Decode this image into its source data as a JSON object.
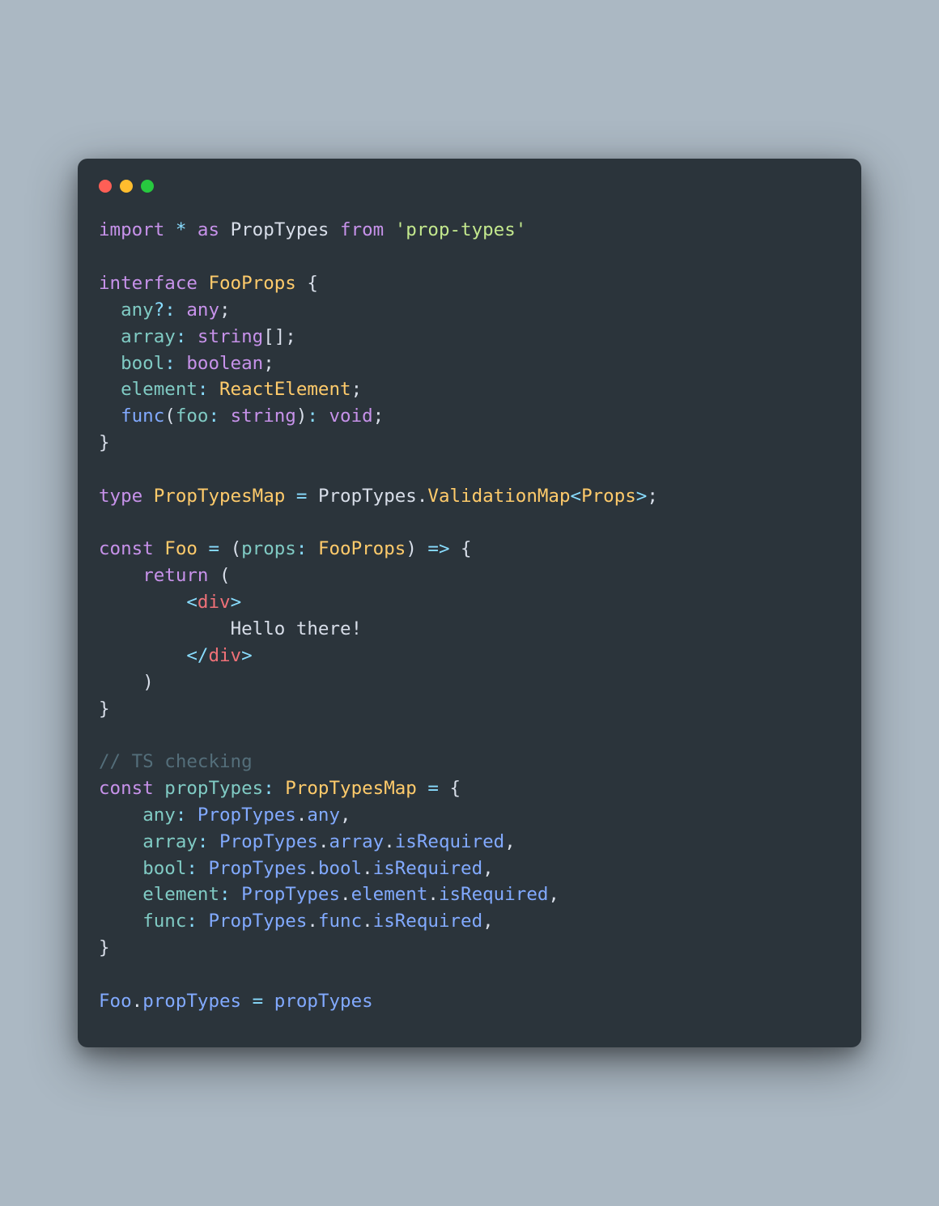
{
  "traffic": {
    "red": "#ff5f56",
    "yellow": "#ffbd2e",
    "green": "#27c93f"
  },
  "code": {
    "line1": {
      "import": "import",
      "star": "*",
      "as": "as",
      "PropTypes": "PropTypes",
      "from": "from",
      "pkg": "'prop-types'"
    },
    "line3": {
      "interface": "interface",
      "FooProps": "FooProps",
      "brace": "{"
    },
    "line4": {
      "prop": "any",
      "q": "?",
      "colon": ":",
      "type": "any",
      "semi": ";"
    },
    "line5": {
      "prop": "array",
      "colon": ":",
      "type": "string",
      "arr": "[]",
      "semi": ";"
    },
    "line6": {
      "prop": "bool",
      "colon": ":",
      "type": "boolean",
      "semi": ";"
    },
    "line7": {
      "prop": "element",
      "colon": ":",
      "type": "ReactElement",
      "semi": ";"
    },
    "line8": {
      "fn": "func",
      "lp": "(",
      "arg": "foo",
      "colon": ":",
      "argtype": "string",
      "rp": ")",
      "colon2": ":",
      "ret": "void",
      "semi": ";"
    },
    "line9": {
      "brace": "}"
    },
    "line11": {
      "type": "type",
      "name": "PropTypesMap",
      "eq": "=",
      "ns": "PropTypes",
      "dot": ".",
      "generic": "ValidationMap",
      "lt": "<",
      "arg": "Props",
      "gt": ">",
      "semi": ";"
    },
    "line13": {
      "const": "const",
      "Foo": "Foo",
      "eq": "=",
      "lp": "(",
      "arg": "props",
      "colon": ":",
      "argtype": "FooProps",
      "rp": ")",
      "arrow": "=>",
      "brace": "{"
    },
    "line14": {
      "return": "return",
      "lp": "("
    },
    "line15": {
      "lt": "<",
      "tag": "div",
      "gt": ">"
    },
    "line16": {
      "text": "Hello there!"
    },
    "line17": {
      "lt": "<",
      "slash": "/",
      "tag": "div",
      "gt": ">"
    },
    "line18": {
      "rp": ")"
    },
    "line19": {
      "brace": "}"
    },
    "line21": {
      "comment": "// TS checking"
    },
    "line22": {
      "const": "const",
      "name": "propTypes",
      "colon": ":",
      "type": "PropTypesMap",
      "eq": "=",
      "brace": "{"
    },
    "line23": {
      "key": "any",
      "colon": ":",
      "ns": "PropTypes",
      "dot": ".",
      "member": "any",
      "comma": ","
    },
    "line24": {
      "key": "array",
      "colon": ":",
      "ns": "PropTypes",
      "dot": ".",
      "m1": "array",
      "dot2": ".",
      "m2": "isRequired",
      "comma": ","
    },
    "line25": {
      "key": "bool",
      "colon": ":",
      "ns": "PropTypes",
      "dot": ".",
      "m1": "bool",
      "dot2": ".",
      "m2": "isRequired",
      "comma": ","
    },
    "line26": {
      "key": "element",
      "colon": ":",
      "ns": "PropTypes",
      "dot": ".",
      "m1": "element",
      "dot2": ".",
      "m2": "isRequired",
      "comma": ","
    },
    "line27": {
      "key": "func",
      "colon": ":",
      "ns": "PropTypes",
      "dot": ".",
      "m1": "func",
      "dot2": ".",
      "m2": "isRequired",
      "comma": ","
    },
    "line28": {
      "brace": "}"
    },
    "line30": {
      "obj": "Foo",
      "dot": ".",
      "prop": "propTypes",
      "eq": "=",
      "val": "propTypes"
    }
  }
}
